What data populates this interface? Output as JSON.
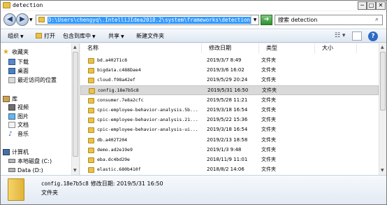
{
  "window": {
    "title": "detection",
    "buttons": {
      "minimize": "─",
      "maximize": "□",
      "close": "✕"
    }
  },
  "address": {
    "path": "D:\\Users\\chengyq\\.IntelliJIdea2018.2\\system\\frameworks\\detection",
    "search_placeholder": "搜索 detection"
  },
  "toolbar": {
    "organize": "组织",
    "open": "打开",
    "include_in_library": "包含到库中",
    "share": "共享",
    "new_folder": "新建文件夹"
  },
  "nav": {
    "favorites": "收藏夹",
    "downloads": "下载",
    "desktop": "桌面",
    "recent": "最近访问的位置",
    "libraries": "库",
    "videos": "视频",
    "pictures": "图片",
    "documents": "文档",
    "music": "音乐",
    "computer": "计算机",
    "local_disk_c": "本地磁盘 (C:)",
    "data_d": "Data (D:)"
  },
  "columns": {
    "name": "名称",
    "date": "修改日期",
    "type": "类型",
    "size": "大小"
  },
  "files": [
    {
      "name": "bd.a402T1c8",
      "date": "2019/3/7 8:49",
      "type": "文件夹"
    },
    {
      "name": "bigdata.c488Dae4",
      "date": "2019/3/6 16:02",
      "type": "文件夹"
    },
    {
      "name": "cloud.f98a42ef",
      "date": "2019/5/29 20:24",
      "type": "文件夹"
    },
    {
      "name": "config.18e7b5c8",
      "date": "2019/5/31 16:50",
      "type": "文件夹"
    },
    {
      "name": "consumer.7e8a2cfc",
      "date": "2019/5/28 11:21",
      "type": "文件夹"
    },
    {
      "name": "cpic-employee-behavior-analysis.5b...",
      "date": "2019/3/18 16:54",
      "type": "文件夹"
    },
    {
      "name": "cpic-employee-behavior-analysis.21...",
      "date": "2019/5/22 15:36",
      "type": "文件夹"
    },
    {
      "name": "cpic-employee-behavior-analysis-ui...",
      "date": "2019/3/18 16:54",
      "type": "文件夹"
    },
    {
      "name": "db.a402T204",
      "date": "2019/2/13 18:58",
      "type": "文件夹"
    },
    {
      "name": "demo.ad2e19e9",
      "date": "2019/1/3 9:48",
      "type": "文件夹"
    },
    {
      "name": "eba.dc4bd29e",
      "date": "2018/11/9 11:01",
      "type": "文件夹"
    },
    {
      "name": "elastic.680b410f",
      "date": "2018/8/2 14:06",
      "type": "文件夹"
    }
  ],
  "selected_index": 3,
  "details": {
    "name": "config.18e7b5c8",
    "modified_label": "修改日期:",
    "modified_value": "2019/5/31 16:50",
    "type": "文件夹"
  }
}
